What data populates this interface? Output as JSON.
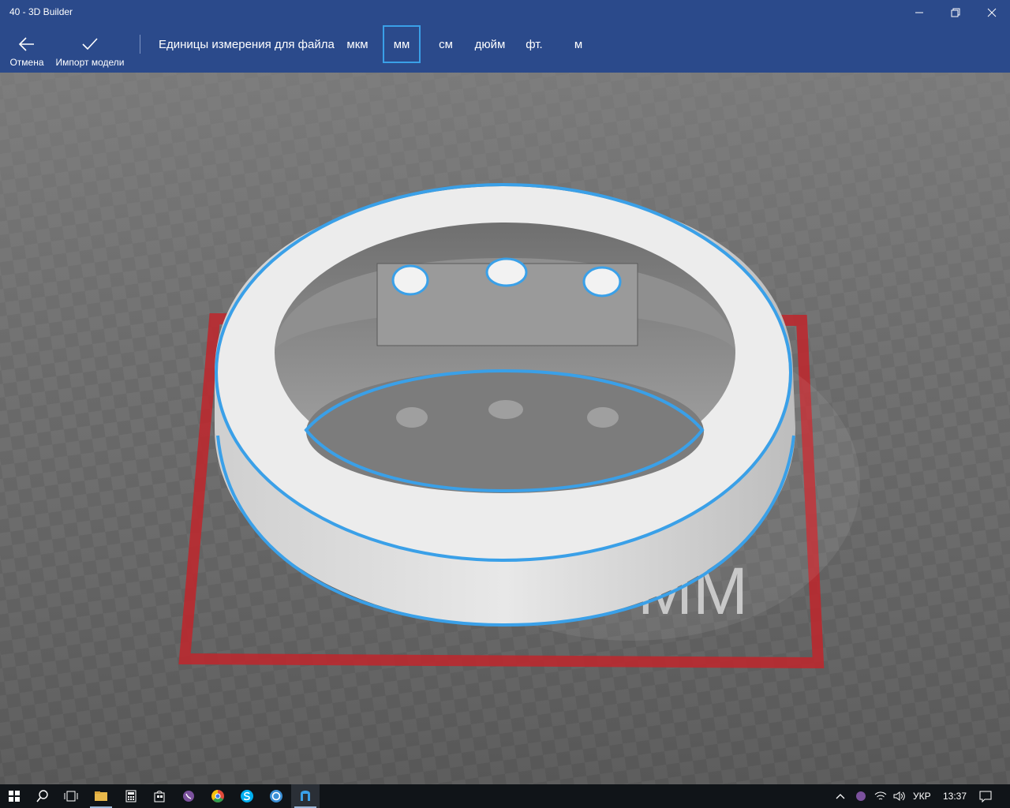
{
  "window": {
    "title": "40 - 3D Builder",
    "minimize_icon": "minimize-icon",
    "maximize_icon": "restore-icon",
    "close_icon": "close-icon"
  },
  "commandbar": {
    "cancel": {
      "label": "Отмена",
      "icon": "back-arrow-icon"
    },
    "import": {
      "label": "Импорт модели",
      "icon": "checkmark-icon"
    },
    "units_label": "Единицы измерения для файла",
    "units": [
      "мкм",
      "мм",
      "см",
      "дюйм",
      "фт.",
      "м"
    ],
    "selected_unit": "мм"
  },
  "viewport": {
    "unit_watermark": "MM",
    "accent_color": "#3aa0e8",
    "plate_color": "#c0262c",
    "model": "ring"
  },
  "taskbar": {
    "apps": [
      "start-icon",
      "search-icon",
      "task-view-icon",
      "file-explorer-icon",
      "calculator-icon",
      "store-icon",
      "viber-icon",
      "chrome-icon",
      "skype-icon",
      "app-icon",
      "3d-builder-icon"
    ],
    "language": "УКР",
    "time": "13:37"
  }
}
